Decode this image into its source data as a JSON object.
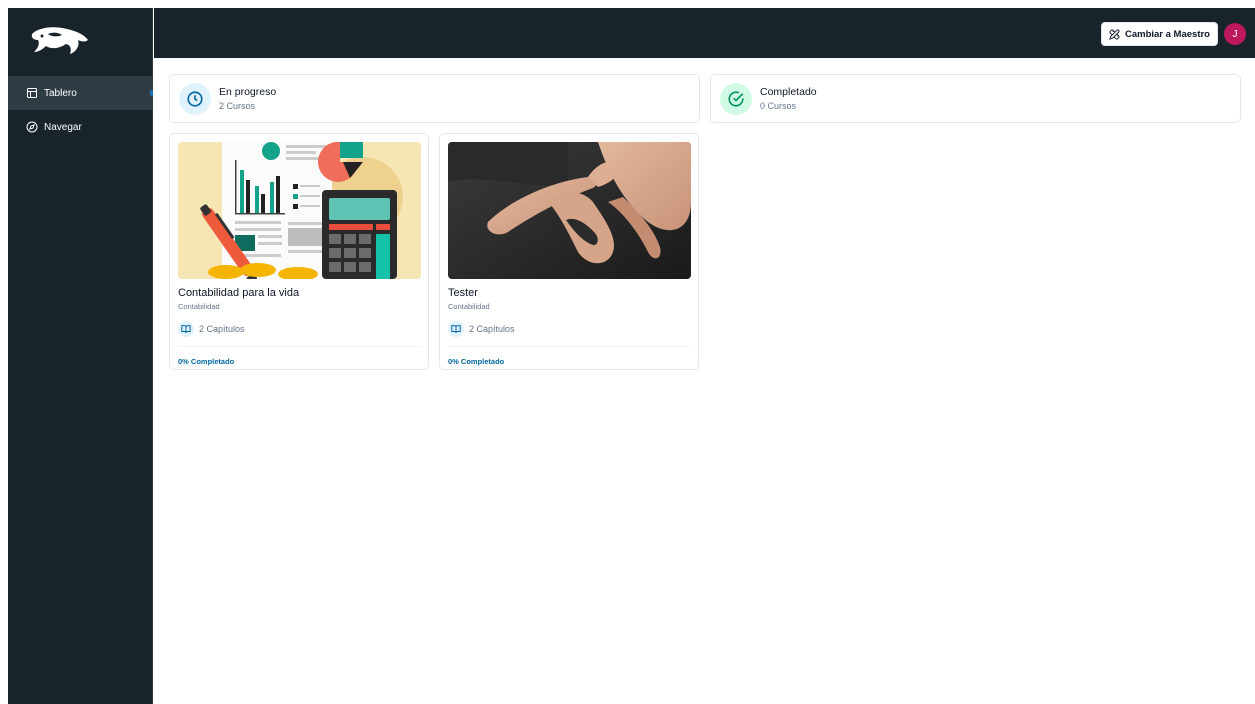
{
  "sidebar": {
    "logo_icon": "orca-logo",
    "items": [
      {
        "label": "Tablero",
        "icon": "layout-icon",
        "active": true
      },
      {
        "label": "Navegar",
        "icon": "compass-icon",
        "active": false
      }
    ]
  },
  "topbar": {
    "switch_label": "Cambiar a Maestro",
    "switch_icon": "pencil-ruler-icon",
    "avatar_initial": "J"
  },
  "summary": {
    "in_progress": {
      "title": "En progreso",
      "subtitle": "2 Cursos",
      "icon": "clock-icon",
      "color": "#0369a1",
      "bg": "#e0f2fe"
    },
    "completed": {
      "title": "Completado",
      "subtitle": "0 Cursos",
      "icon": "check-circle-icon",
      "color": "#059669",
      "bg": "#d1fae5"
    }
  },
  "courses": [
    {
      "title": "Contabilidad para la vida",
      "category": "Contabilidad",
      "chapters": "2 Capítulos",
      "progress": "0% Completado",
      "progress_value": 0,
      "image": "accounting-illustration"
    },
    {
      "title": "Tester",
      "category": "Contabilidad",
      "chapters": "2 Capítulos",
      "progress": "0% Completado",
      "progress_value": 0,
      "image": "hand-photo"
    }
  ],
  "colors": {
    "dark": "#18242a",
    "accent": "#0369a1",
    "avatar": "#be185d"
  }
}
